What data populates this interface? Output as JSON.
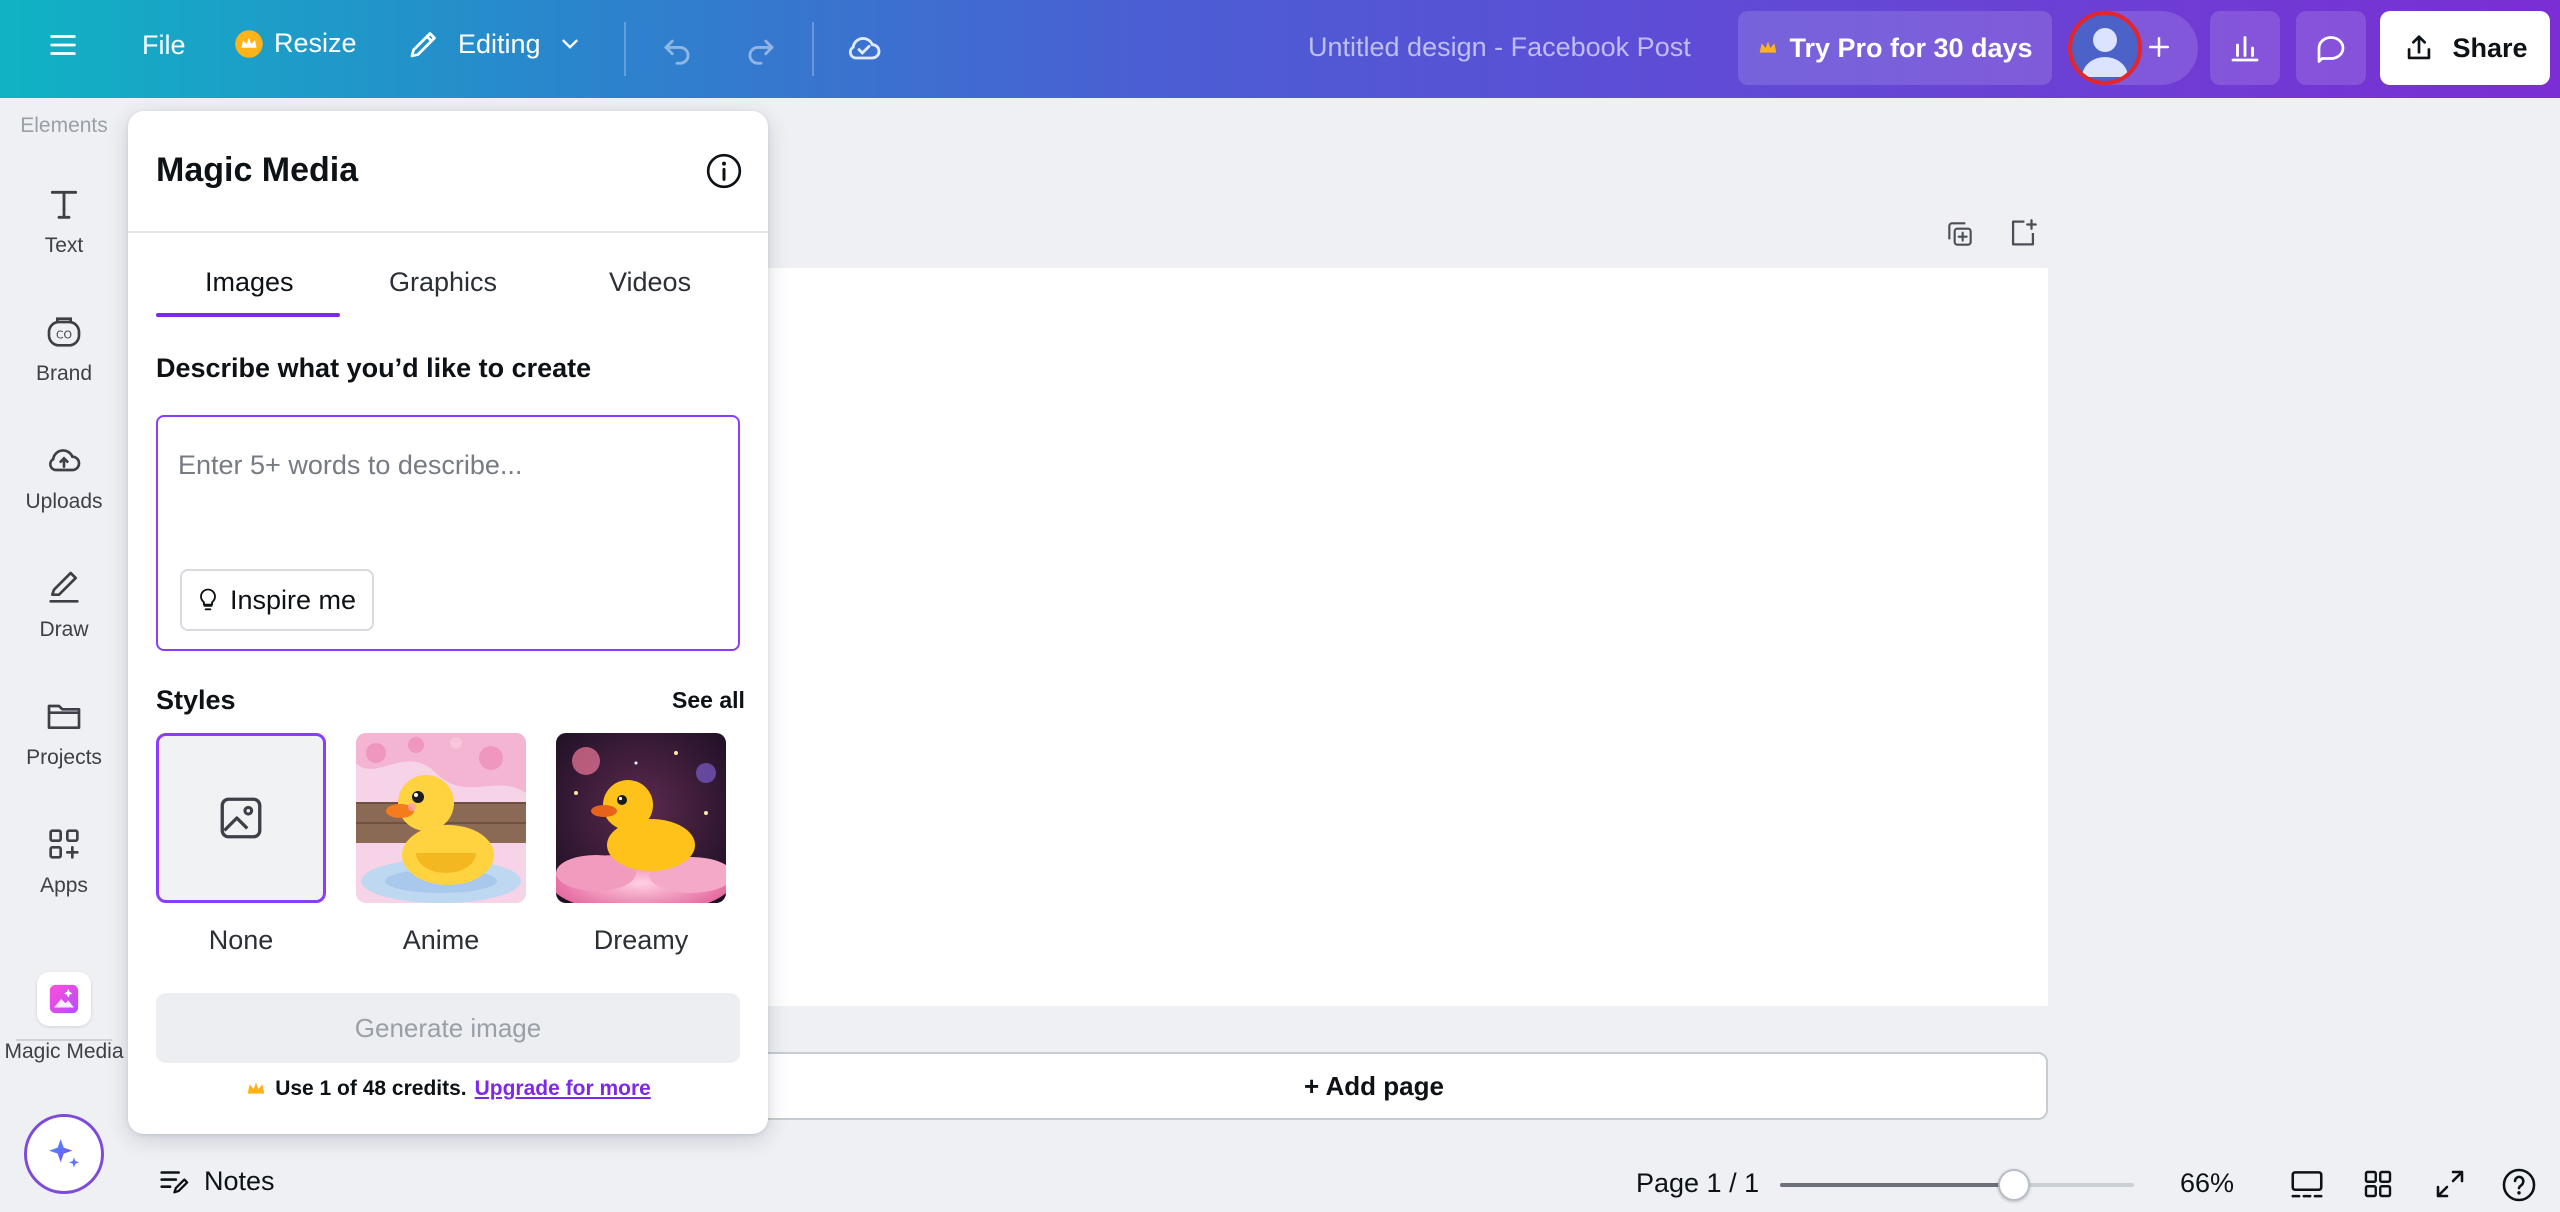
{
  "topbar": {
    "file_label": "File",
    "resize_label": "Resize",
    "editing_label": "Editing",
    "doc_title": "Untitled design - Facebook Post",
    "pro_label": "Try Pro for 30 days",
    "share_label": "Share"
  },
  "rail": {
    "items": [
      {
        "label": "Elements",
        "icon": "elements-icon"
      },
      {
        "label": "Text",
        "icon": "text-icon"
      },
      {
        "label": "Brand",
        "icon": "brand-icon"
      },
      {
        "label": "Uploads",
        "icon": "cloud-upload-icon"
      },
      {
        "label": "Draw",
        "icon": "pen-icon"
      },
      {
        "label": "Projects",
        "icon": "folder-icon"
      },
      {
        "label": "Apps",
        "icon": "apps-icon"
      },
      {
        "label": "Magic Media",
        "icon": "magic-media-icon"
      }
    ]
  },
  "panel": {
    "title": "Magic Media",
    "tabs": [
      {
        "label": "Images",
        "active": true
      },
      {
        "label": "Graphics",
        "active": false
      },
      {
        "label": "Videos",
        "active": false
      }
    ],
    "describe_label": "Describe what you’d like to create",
    "prompt_placeholder": "Enter 5+ words to describe...",
    "prompt_value": "",
    "inspire_label": "Inspire me",
    "styles_label": "Styles",
    "see_all_label": "See all",
    "styles": [
      {
        "name": "None",
        "selected": true
      },
      {
        "name": "Anime",
        "selected": false
      },
      {
        "name": "Dreamy",
        "selected": false
      }
    ],
    "generate_label": "Generate image",
    "credits_text": "Use 1 of 48 credits.",
    "upgrade_label": "Upgrade for more"
  },
  "canvas": {
    "add_page_label": "+ Add page"
  },
  "bottombar": {
    "notes_label": "Notes",
    "page_label": "Page 1 / 1",
    "zoom_label": "66%",
    "zoom_fraction": 0.66
  },
  "colors": {
    "accent": "#8b3dff",
    "tab_underline": "#7d2ae8",
    "topbar_start": "#10b3c4",
    "topbar_end": "#7a2ed3"
  }
}
